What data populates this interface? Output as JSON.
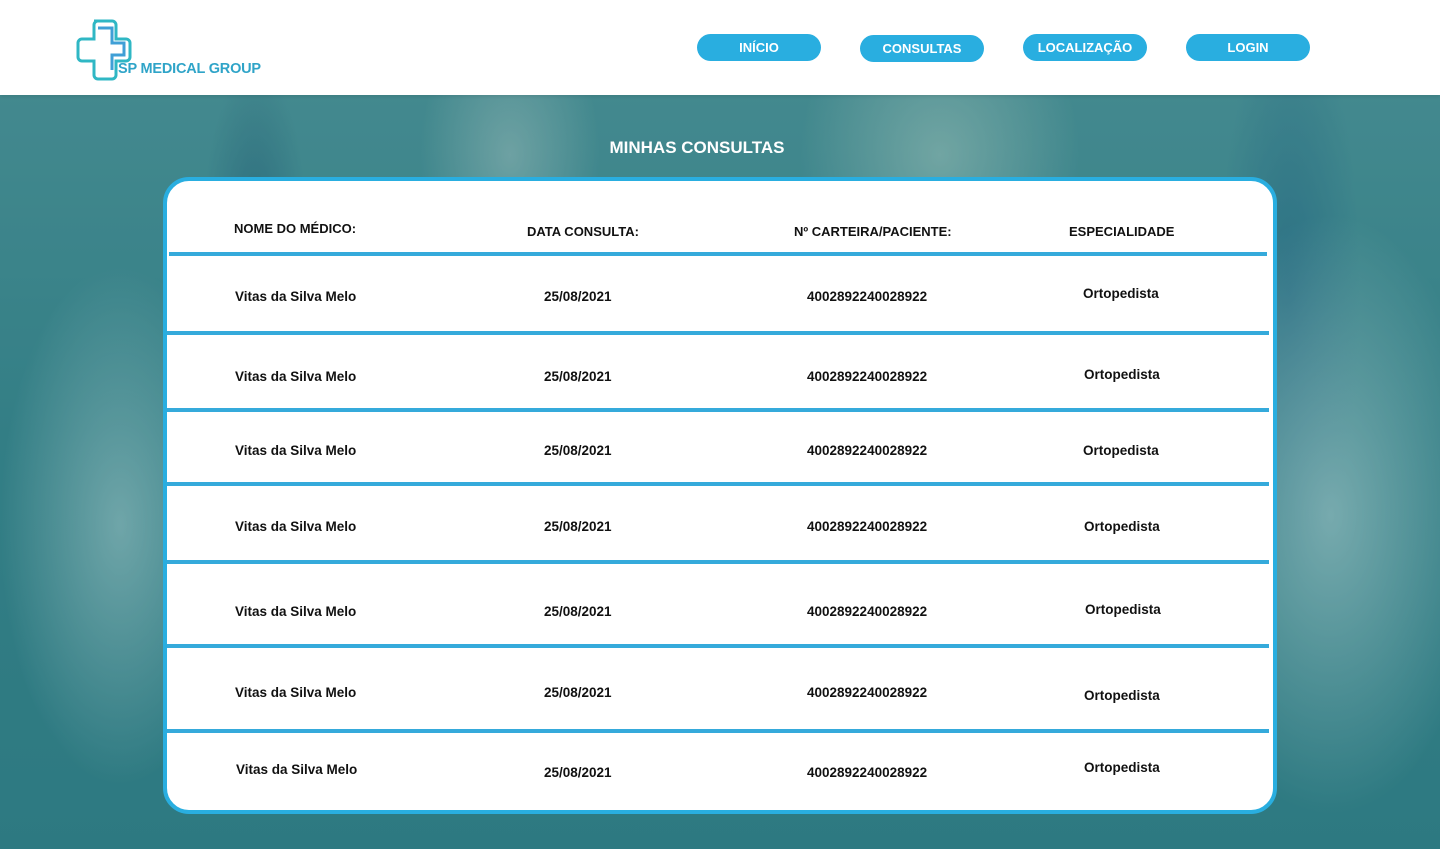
{
  "header": {
    "logo_text": "SP MEDICAL GROUP",
    "nav": [
      {
        "label": "INÍCIO"
      },
      {
        "label": "CONSULTAS"
      },
      {
        "label": "LOCALIZAÇÃO"
      },
      {
        "label": "LOGIN"
      }
    ]
  },
  "page_title": "MINHAS CONSULTAS",
  "table": {
    "columns": [
      "NOME DO MÉDICO:",
      "DATA CONSULTA:",
      "Nº CARTEIRA/PACIENTE:",
      "ESPECIALIDADE"
    ],
    "rows": [
      {
        "medico": "Vitas da Silva Melo",
        "data": "25/08/2021",
        "carteira": "4002892240028922",
        "especialidade": "Ortopedista"
      },
      {
        "medico": "Vitas da Silva Melo",
        "data": "25/08/2021",
        "carteira": "4002892240028922",
        "especialidade": "Ortopedista"
      },
      {
        "medico": "Vitas da Silva Melo",
        "data": "25/08/2021",
        "carteira": "4002892240028922",
        "especialidade": "Ortopedista"
      },
      {
        "medico": "Vitas da Silva Melo",
        "data": "25/08/2021",
        "carteira": "4002892240028922",
        "especialidade": "Ortopedista"
      },
      {
        "medico": "Vitas da Silva Melo",
        "data": "25/08/2021",
        "carteira": "4002892240028922",
        "especialidade": "Ortopedista"
      },
      {
        "medico": "Vitas da Silva Melo",
        "data": "25/08/2021",
        "carteira": "4002892240028922",
        "especialidade": "Ortopedista"
      },
      {
        "medico": "Vitas da Silva Melo",
        "data": "25/08/2021",
        "carteira": "4002892240028922",
        "especialidade": "Ortopedista"
      }
    ]
  },
  "colors": {
    "accent": "#29aee0",
    "logo": "#2fa4c8",
    "background_tint": "#3a8189"
  },
  "icons": [
    "medical-cross-icon"
  ]
}
